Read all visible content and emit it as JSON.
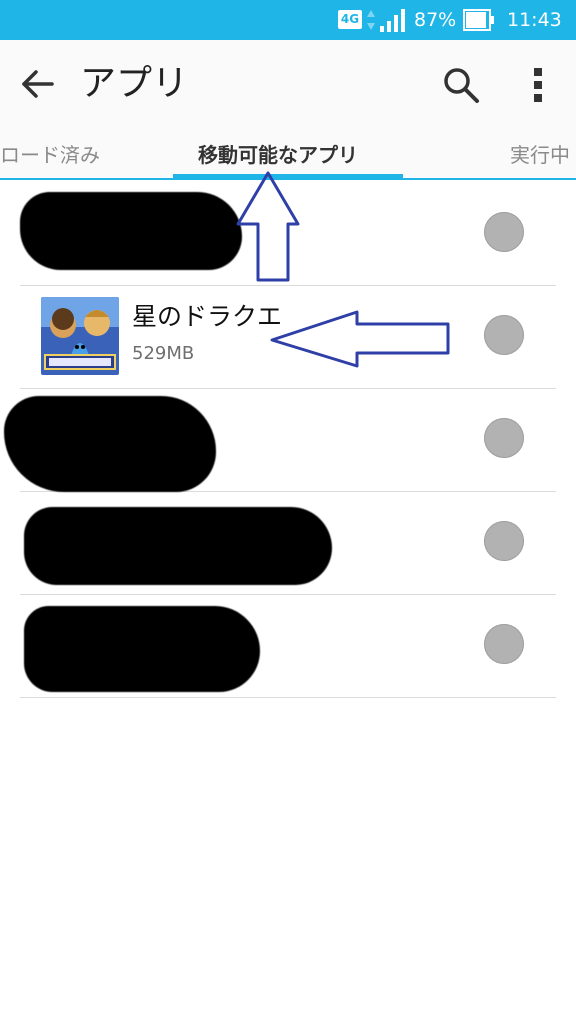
{
  "status_bar": {
    "network": "4G",
    "battery_percent": "87%",
    "time": "11:43"
  },
  "toolbar": {
    "title": "アプリ",
    "icons": [
      "back-arrow-icon",
      "search-icon",
      "more-vert-icon"
    ]
  },
  "tabs": [
    {
      "label": "ロード済み"
    },
    {
      "label": "移動可能なアプリ",
      "active": true
    },
    {
      "label": "実行中"
    }
  ],
  "apps": [
    {
      "name": "",
      "redacted": true,
      "selected": false
    },
    {
      "name": "星のドラクエ",
      "size": "529MB",
      "redacted": false,
      "selected": false
    },
    {
      "name": "",
      "redacted": true,
      "selected": false
    },
    {
      "name": "",
      "redacted": true,
      "selected": false
    },
    {
      "name": "",
      "redacted": true,
      "selected": false
    }
  ],
  "colors": {
    "accent": "#1fb5e6",
    "annotation_arrow": "#2e3fa8",
    "radio": "#b2b2b2"
  }
}
